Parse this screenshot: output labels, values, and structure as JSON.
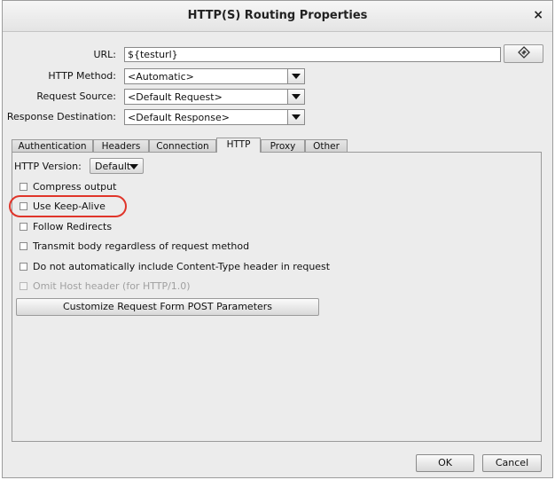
{
  "window": {
    "title": "HTTP(S) Routing Properties",
    "close_glyph": "×"
  },
  "form": {
    "url_label": "URL:",
    "url_value": "${testurl}",
    "method_label": "HTTP Method:",
    "method_value": "<Automatic>",
    "source_label": "Request Source:",
    "source_value": "<Default Request>",
    "destination_label": "Response Destination:",
    "destination_value": "<Default Response>"
  },
  "tabs": [
    {
      "label": "Authentication",
      "active": false
    },
    {
      "label": "Headers",
      "active": false
    },
    {
      "label": "Connection",
      "active": false
    },
    {
      "label": "HTTP",
      "active": true
    },
    {
      "label": "Proxy",
      "active": false
    },
    {
      "label": "Other",
      "active": false
    }
  ],
  "http_tab": {
    "version_label": "HTTP Version:",
    "version_value": "Default",
    "options": [
      {
        "label": "Compress output",
        "checked": false,
        "enabled": true
      },
      {
        "label": "Use Keep-Alive",
        "checked": false,
        "enabled": true,
        "highlighted": true
      },
      {
        "label": "Follow Redirects",
        "checked": false,
        "enabled": true
      },
      {
        "label": "Transmit body regardless of request method",
        "checked": false,
        "enabled": true
      },
      {
        "label": "Do not automatically include Content-Type header in request",
        "checked": false,
        "enabled": true
      },
      {
        "label": "Omit Host header (for HTTP/1.0)",
        "checked": false,
        "enabled": false
      }
    ],
    "customize_button": "Customize Request Form POST Parameters"
  },
  "footer": {
    "ok_label": "OK",
    "cancel_label": "Cancel"
  },
  "colors": {
    "highlight_ring": "#e0352a",
    "dialog_bg": "#ececec"
  },
  "icons": {
    "url_button_icon": "context-variable-icon"
  }
}
